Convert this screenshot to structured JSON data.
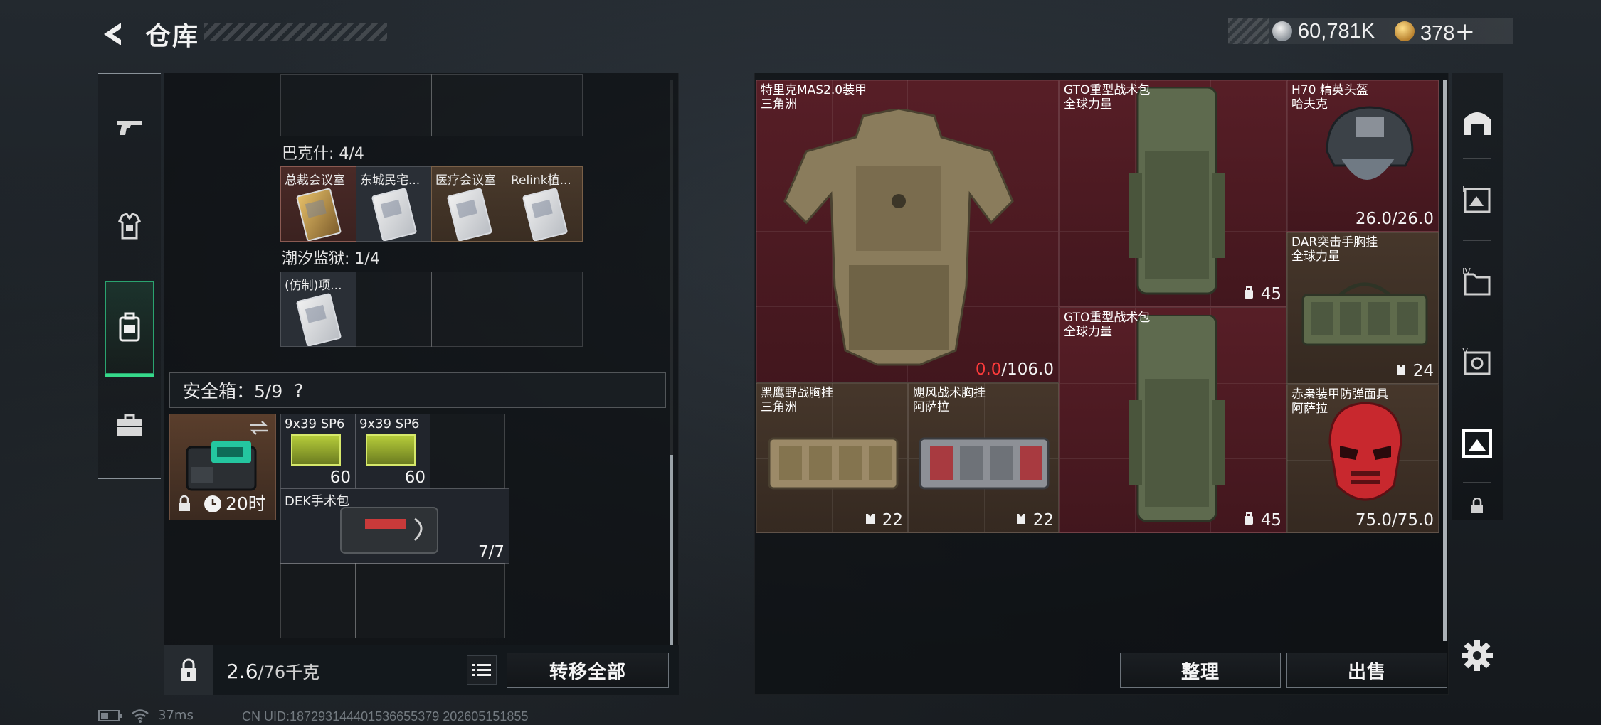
{
  "header": {
    "title": "仓库"
  },
  "currency": {
    "silver": "60,781K",
    "gold": "378＋"
  },
  "left_nav": [
    "weapons",
    "armor",
    "backpack",
    "briefcase"
  ],
  "key_sections": [
    {
      "title": "巴克什: 4/4",
      "keys": [
        "总裁会议室",
        "东城民宅...",
        "医疗会议室",
        "Relink植..."
      ]
    },
    {
      "title": "潮汐监狱: 1/4",
      "keys": [
        "(仿制)项..."
      ]
    }
  ],
  "safe": {
    "label": "安全箱：5/9",
    "help": "?",
    "timer": "20时",
    "items": [
      {
        "name": "9x39 SP6",
        "count": "60"
      },
      {
        "name": "9x39 SP6",
        "count": "60"
      },
      {
        "name": "DEK手术包",
        "count": "7/7"
      }
    ]
  },
  "weight": {
    "value": "2.6",
    "unit": "/76千克"
  },
  "buttons": {
    "transfer_all": "转移全部",
    "organize": "整理",
    "sell": "出售"
  },
  "inventory": [
    {
      "name": "特里克MAS2.0装甲",
      "sub": "三角洲",
      "stat_red": "0.0",
      "stat": "/106.0"
    },
    {
      "name": "GTO重型战术包",
      "sub": "全球力量",
      "stat": "45"
    },
    {
      "name": "H70 精英头盔",
      "sub": "哈夫克",
      "stat": "26.0/26.0"
    },
    {
      "name": "DAR突击手胸挂",
      "sub": "全球力量",
      "stat": "24"
    },
    {
      "name": "GTO重型战术包",
      "sub": "全球力量",
      "stat": "45"
    },
    {
      "name": "黑鹰野战胸挂",
      "sub": "三角洲",
      "stat": "22"
    },
    {
      "name": "飓风战术胸挂",
      "sub": "阿萨拉",
      "stat": "22"
    },
    {
      "name": "赤枭装甲防弹面具",
      "sub": "阿萨拉",
      "stat": "75.0/75.0"
    }
  ],
  "status": {
    "ping": "37ms",
    "uid": "CN UID:187293144401536655379 202605151855"
  }
}
